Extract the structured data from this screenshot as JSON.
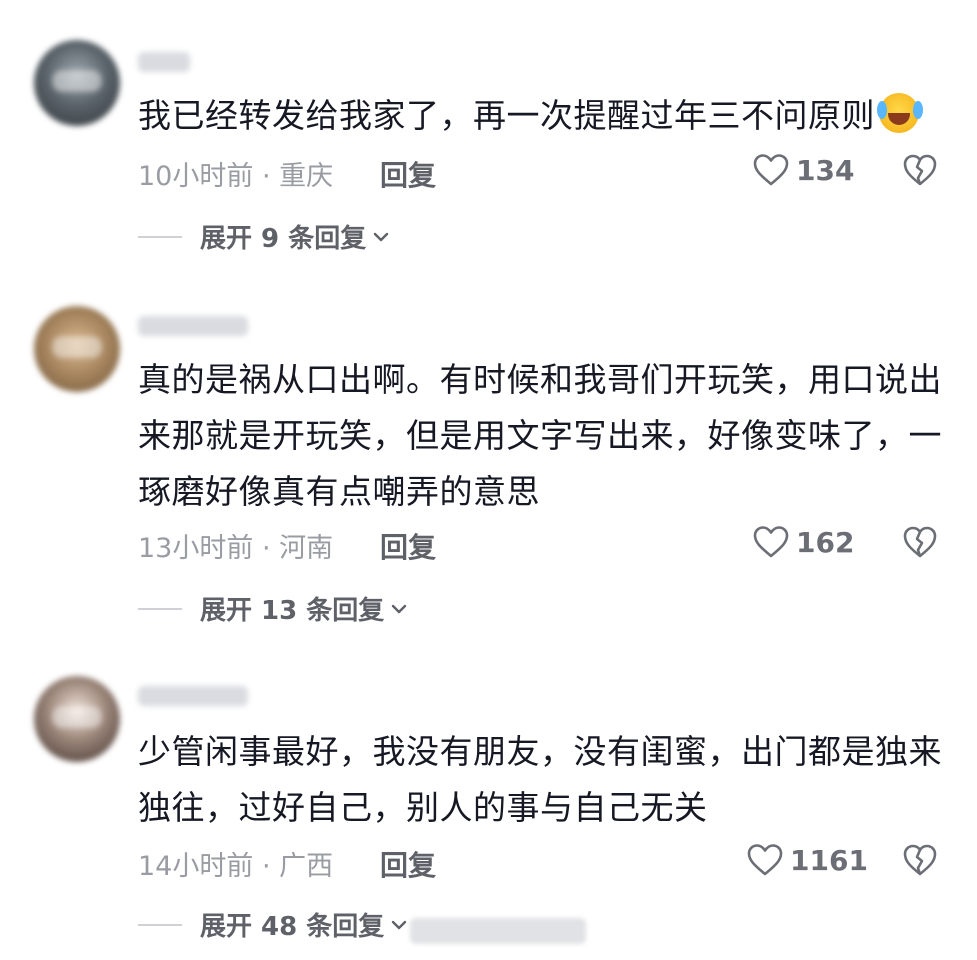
{
  "comments": [
    {
      "text": "我已经转发给我家了，再一次提醒过年三不问原则",
      "emoji": "laughing-crying-emoji",
      "time_location": "10小时前 · 重庆",
      "reply_label": "回复",
      "likes": "134",
      "expand_label": "展开 9 条回复"
    },
    {
      "text": "真的是祸从口出啊。有时候和我哥们开玩笑，用口说出来那就是开玩笑，但是用文字写出来，好像变味了，一琢磨好像真有点嘲弄的意思",
      "time_location": "13小时前 · 河南",
      "reply_label": "回复",
      "likes": "162",
      "expand_label": "展开 13 条回复"
    },
    {
      "text": "少管闲事最好，我没有朋友，没有闺蜜，出门都是独来独往，过好自己，别人的事与自己无关",
      "time_location": "14小时前 · 广西",
      "reply_label": "回复",
      "likes": "1161",
      "expand_label": "展开 48 条回复"
    }
  ],
  "icons": {
    "like": "heart-outline-icon",
    "dislike": "broken-heart-icon",
    "expand": "chevron-down-icon"
  },
  "colors": {
    "text": "#161823",
    "meta": "#9a9ca3",
    "action": "#5f6168"
  }
}
